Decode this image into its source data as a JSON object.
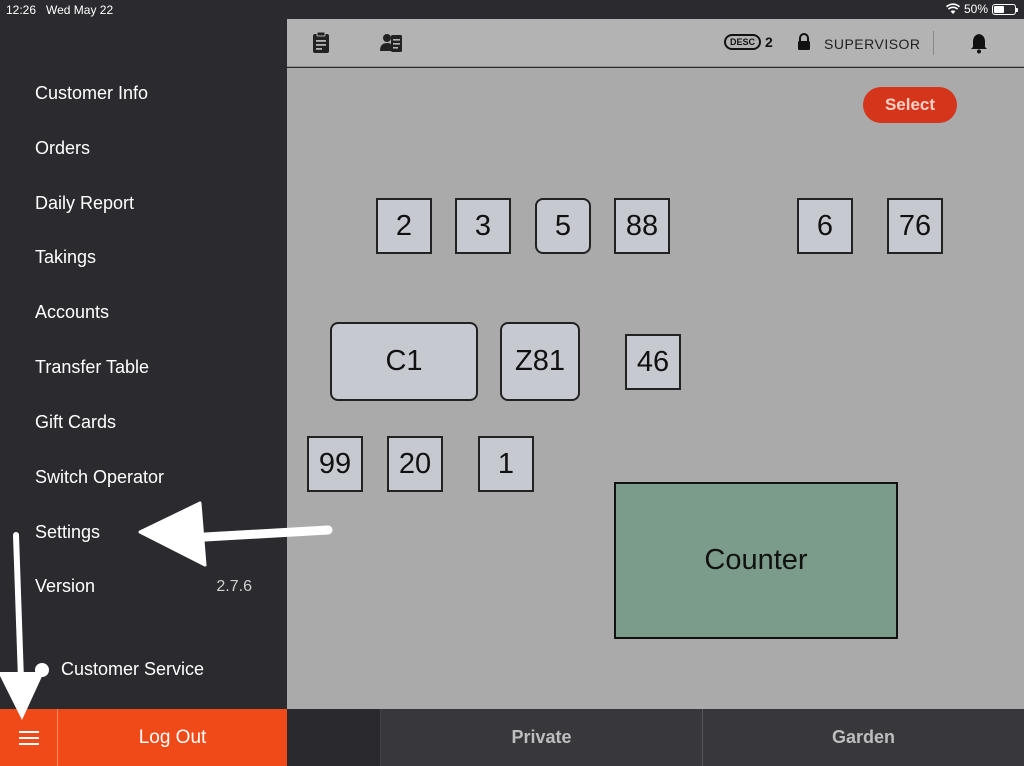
{
  "status": {
    "time": "12:26",
    "date": "Wed May 22",
    "battery": "50%",
    "battery_level": 0.5
  },
  "menu": {
    "items": [
      {
        "label": "Customer Info"
      },
      {
        "label": "Orders"
      },
      {
        "label": "Daily Report"
      },
      {
        "label": "Takings"
      },
      {
        "label": "Accounts"
      },
      {
        "label": "Transfer Table"
      },
      {
        "label": "Gift Cards"
      },
      {
        "label": "Switch Operator"
      },
      {
        "label": "Settings"
      }
    ],
    "version_label": "Version",
    "version_value": "2.7.6",
    "customer_service": "Customer Service"
  },
  "bottom": {
    "logout": "Log Out",
    "tabs": [
      "",
      "Private",
      "Garden"
    ]
  },
  "toolbar": {
    "desc_badge": "DESC",
    "desc_count": "2",
    "role": "SUPERVISOR"
  },
  "floor": {
    "select": "Select",
    "tables": [
      "2",
      "3",
      "5",
      "88",
      "6",
      "76",
      "C1",
      "Z81",
      "46",
      "99",
      "20",
      "1"
    ],
    "counter": "Counter"
  },
  "colors": {
    "accent": "#f04a19",
    "select": "#d5351b",
    "counter": "#7b9b8b",
    "sidebar": "#2b2b2f",
    "floor": "#aaaaaa"
  },
  "icons": [
    "wifi-icon",
    "battery-icon",
    "clipboard-icon",
    "customer-card-icon",
    "lock-icon",
    "bell-icon",
    "hamburger-icon",
    "headset-icon"
  ]
}
